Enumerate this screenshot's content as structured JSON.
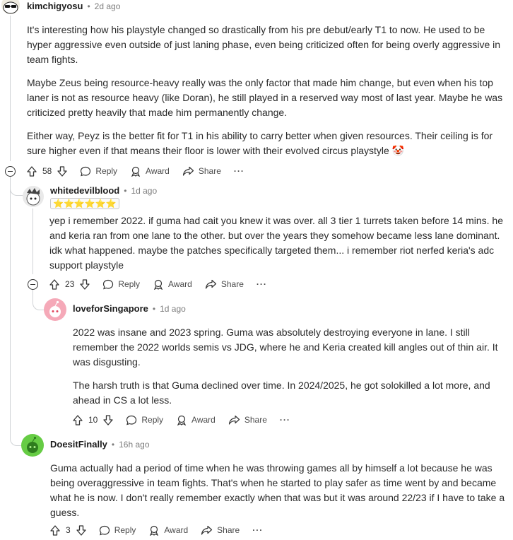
{
  "comments": [
    {
      "username": "kimchigyosu",
      "time": "2d ago",
      "paragraphs": [
        "It's interesting how his playstyle changed so drastically from his pre debut/early T1 to now. He used to be hyper aggressive even outside of just laning phase, even being criticized often for being overly aggressive in team fights.",
        "Maybe Zeus being resource-heavy really was the only factor that made him change, but even when his top laner is not as resource heavy (like Doran), he still played in a reserved way most of last year. Maybe he was criticized pretty heavily that made him permanently change.",
        "Either way, Peyz is the better fit for T1 in his ability to carry better when given resources. Their ceiling is for sure higher even if that means their floor is lower with their evolved circus playstyle 🤡"
      ],
      "votes": "58"
    },
    {
      "username": "whitedevilblood",
      "time": "1d ago",
      "flair": "⭐⭐⭐⭐⭐⭐",
      "paragraphs": [
        "yep i remember 2022. if guma had cait you knew it was over. all 3 tier 1 turrets taken before 14 mins. he and keria ran from one lane to the other. but over the years they somehow became less lane dominant. idk what happened. maybe the patches specifically targeted them... i remember riot nerfed keria's adc support playstyle"
      ],
      "votes": "23"
    },
    {
      "username": "loveforSingapore",
      "time": "1d ago",
      "paragraphs": [
        "2022 was insane and 2023 spring. Guma was absolutely destroying everyone in lane. I still remember the 2022 worlds semis vs JDG, where he and Keria created kill angles out of thin air. It was disgusting.",
        "The harsh truth is that Guma declined over time. In 2024/2025, he got solokilled a lot more, and ahead in CS a lot less."
      ],
      "votes": "10"
    },
    {
      "username": "DoesitFinally",
      "time": "16h ago",
      "paragraphs": [
        "Guma actually had a period of time when he was throwing games all by himself a lot because he was being overaggressive in team fights. That's when he started to play safer as time went by and became what he is now. I don't really remember exactly when that was but it was around 22/23 if I have to take a guess."
      ],
      "votes": "3"
    }
  ],
  "labels": {
    "dot": "•",
    "reply": "Reply",
    "award": "Award",
    "share": "Share",
    "more": "···"
  },
  "icons": [
    "upvote-icon",
    "downvote-icon",
    "reply-icon",
    "award-icon",
    "share-icon",
    "more-icon",
    "collapse-icon"
  ],
  "colors": {
    "text": "#2a2a2a",
    "meta": "#7c7c7c",
    "thread": "#d0d3d6",
    "avatar_pink": "#f5a9b8",
    "avatar_green": "#66cc44"
  }
}
